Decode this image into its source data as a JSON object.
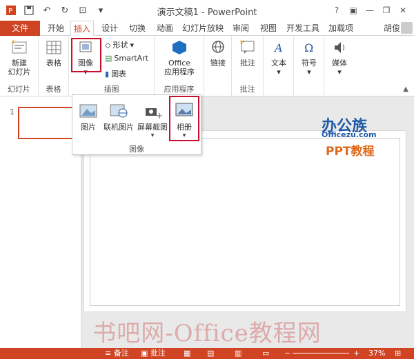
{
  "titlebar": {
    "title": "演示文稿1 - PowerPoint",
    "help": "?"
  },
  "tabs": {
    "file": "文件",
    "items": [
      "开始",
      "插入",
      "设计",
      "切换",
      "动画",
      "幻灯片放映",
      "审阅",
      "视图",
      "开发工具",
      "加载项"
    ],
    "active": "插入",
    "user": "胡俊"
  },
  "ribbon": {
    "new_slide": [
      "新建",
      "幻灯片"
    ],
    "table": "表格",
    "image": "图像",
    "shapes": "形状",
    "smartart": "SmartArt",
    "chart": "图表",
    "office": [
      "Office",
      "应用程序"
    ],
    "link": "链接",
    "comment": "批注",
    "text": "文本",
    "symbol": "符号",
    "media": "媒体",
    "groups": {
      "slides": "幻灯片",
      "tables": "表格",
      "illustrations": "插图",
      "apps": "应用程序",
      "comments": "批注"
    }
  },
  "dropdown": {
    "items": [
      "图片",
      "联机图片",
      "屏幕截图",
      "相册"
    ],
    "label": "图像"
  },
  "slides": {
    "thumb_number": "1"
  },
  "watermark": {
    "logo_title": "办公族",
    "logo_sub": "Officezu.com",
    "logo_ppt": "PPT教程",
    "bottom": "书吧网-Office教程网"
  },
  "status": {
    "notes": "备注",
    "comments": "批注",
    "zoom": "37%"
  },
  "colors": {
    "accent": "#d04424",
    "highlight": "#c8102e"
  }
}
